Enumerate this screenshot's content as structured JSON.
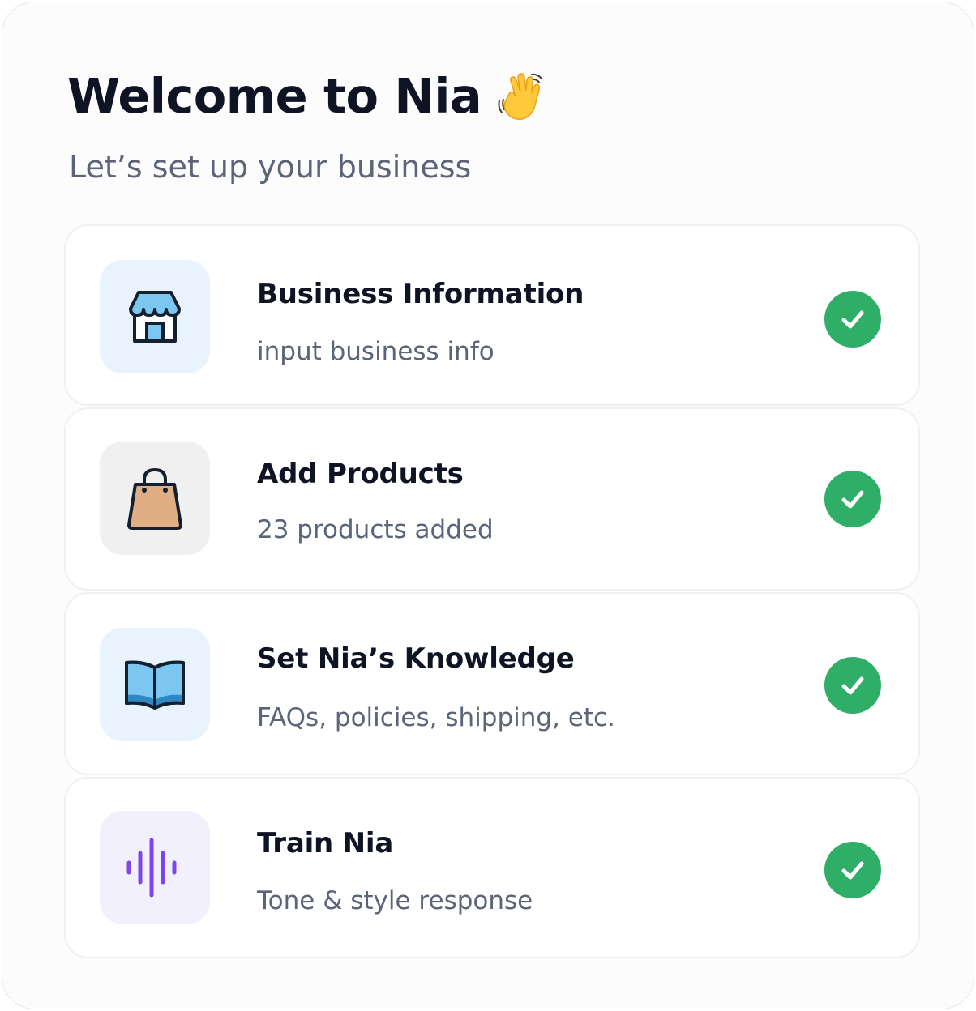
{
  "header": {
    "title": "Welcome to Nia",
    "wave_icon": "waving-hand-icon",
    "subtitle": "Let’s set up your business"
  },
  "steps": [
    {
      "title": "Business Information",
      "description": "input business info",
      "icon": "storefront-icon",
      "status": "completed"
    },
    {
      "title": "Add Products",
      "description": "23 products added",
      "icon": "shopping-bag-icon",
      "status": "completed"
    },
    {
      "title": "Set Nia’s Knowledge",
      "description": "FAQs, policies, shipping, etc.",
      "icon": "open-book-icon",
      "status": "completed"
    },
    {
      "title": "Train Nia",
      "description": "Tone & style response",
      "icon": "sound-wave-icon",
      "status": "completed"
    }
  ],
  "colors": {
    "check_green": "#2fae68",
    "title_text": "#0f1424",
    "muted_text": "#5b6478",
    "voice_purple": "#7b46f0"
  }
}
